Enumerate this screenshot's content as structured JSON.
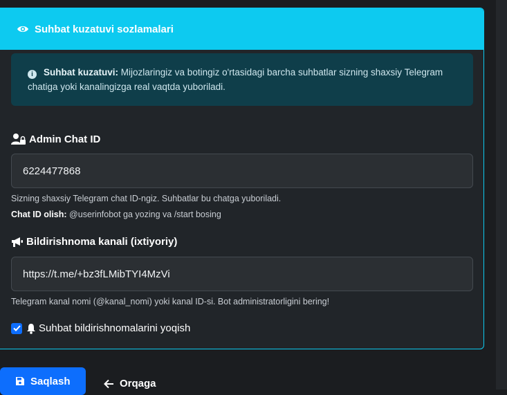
{
  "card": {
    "title": "Suhbat kuzatuvi sozlamalari",
    "alert_bold": "Suhbat kuzatuvi:",
    "alert_text": "Mijozlaringiz va botingiz o'rtasidagi barcha suhbatlar sizning shaxsiy Telegram",
    "alert_text2": "chatiga yoki kanalingizga real vaqtda yuboriladi."
  },
  "admin": {
    "label": "Admin Chat ID",
    "value": "6224477868",
    "help": "Sizning shaxsiy Telegram chat ID-ngiz. Suhbatlar bu chatga yuboriladi.",
    "help2_bold": "Chat ID olish:",
    "help2_text": "@userinfobot ga yozing va /start bosing"
  },
  "channel": {
    "label": "Bildirishnoma kanali (ixtiyoriy)",
    "value": "https://t.me/+bz3fLMibTYI4MzVi",
    "help": "Telegram kanal nomi (@kanal_nomi) yoki kanal ID-si. Bot administratorligini bering!"
  },
  "toggle": {
    "label": "Suhbat bildirishnomalarini yoqish",
    "checked": true
  },
  "buttons": {
    "save": "Saqlash",
    "back": "Orqaga"
  },
  "icons": {
    "header": "eye-icon",
    "info": "info-circle-icon",
    "admin": "user-lock-icon",
    "channel": "bullhorn-icon",
    "bell": "bell-icon",
    "save": "floppy-disk-icon",
    "back": "arrow-left-icon"
  },
  "colors": {
    "accent": "#0dcaf0",
    "primary": "#0d6efd",
    "background": "#212529"
  }
}
